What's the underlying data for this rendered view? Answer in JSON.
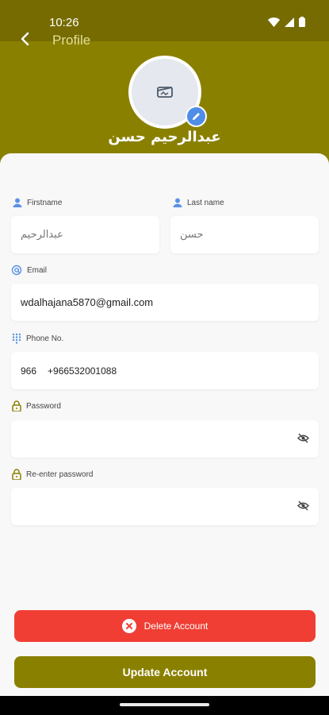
{
  "status_bar": {
    "time": "10:26"
  },
  "header": {
    "title": "Profile",
    "user_name": "عبدالرحيم حسن"
  },
  "form": {
    "firstname": {
      "label": "Firstname",
      "value": "عبدالرحيم"
    },
    "lastname": {
      "label": "Last name",
      "value": "حسن"
    },
    "email": {
      "label": "Email",
      "value": "wdalhajana5870@gmail.com"
    },
    "phone": {
      "label": "Phone No.",
      "country_code": "966",
      "value": "+966532001088"
    },
    "password": {
      "label": "Password",
      "value": ""
    },
    "reenter_password": {
      "label": "Re-enter password",
      "value": ""
    }
  },
  "actions": {
    "delete_label": "Delete Account",
    "update_label": "Update Account"
  },
  "colors": {
    "brand": "#8a8000",
    "status_bar": "#766b00",
    "danger": "#f03e34",
    "accent_blue": "#4f8de6"
  },
  "icons": [
    "back-arrow-icon",
    "wifi-icon",
    "signal-icon",
    "battery-icon",
    "image-placeholder-icon",
    "pencil-icon",
    "person-icon",
    "at-icon",
    "dialpad-icon",
    "lock-icon",
    "eye-off-icon",
    "close-circle-icon"
  ]
}
